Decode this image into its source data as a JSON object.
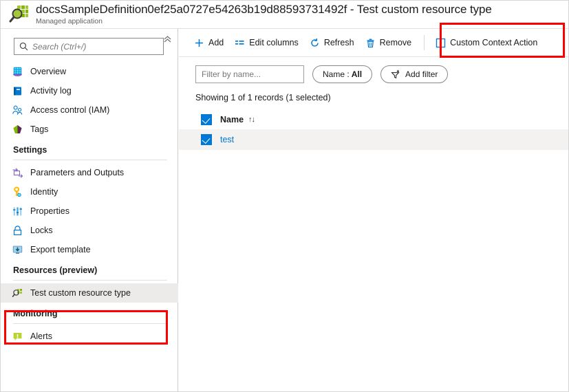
{
  "header": {
    "title": "docsSampleDefinition0ef25a0727e54263b19d88593731492f - Test custom resource type",
    "subtitle": "Managed application",
    "logo_icon": "custom-provider-magnifier-icon"
  },
  "sidebar": {
    "search": {
      "placeholder": "Search (Ctrl+/)",
      "value": "",
      "icon": "search-icon"
    },
    "collapse_icon": "double-chevron-up-icon",
    "items": [
      {
        "label": "Overview",
        "icon": "overview-cube-icon",
        "type": "item",
        "selected": false
      },
      {
        "label": "Activity log",
        "icon": "activity-log-icon",
        "type": "item",
        "selected": false
      },
      {
        "label": "Access control (IAM)",
        "icon": "access-control-icon",
        "type": "item",
        "selected": false
      },
      {
        "label": "Tags",
        "icon": "tags-icon",
        "type": "item",
        "selected": false
      },
      {
        "label": "Settings",
        "icon": "",
        "type": "group",
        "selected": false
      },
      {
        "label": "Parameters and Outputs",
        "icon": "parameters-outputs-icon",
        "type": "item",
        "selected": false
      },
      {
        "label": "Identity",
        "icon": "identity-key-icon",
        "type": "item",
        "selected": false
      },
      {
        "label": "Properties",
        "icon": "properties-icon",
        "type": "item",
        "selected": false
      },
      {
        "label": "Locks",
        "icon": "lock-icon",
        "type": "item",
        "selected": false
      },
      {
        "label": "Export template",
        "icon": "export-template-icon",
        "type": "item",
        "selected": false
      },
      {
        "label": "Resources (preview)",
        "icon": "",
        "type": "group",
        "selected": false
      },
      {
        "label": "Test custom resource type",
        "icon": "custom-resource-type-icon",
        "type": "item",
        "selected": true
      },
      {
        "label": "Monitoring",
        "icon": "",
        "type": "group",
        "selected": false
      },
      {
        "label": "Alerts",
        "icon": "alerts-icon",
        "type": "item",
        "selected": false
      }
    ]
  },
  "toolbar": {
    "buttons": [
      {
        "label": "Add",
        "icon": "plus-icon"
      },
      {
        "label": "Edit columns",
        "icon": "edit-columns-icon"
      },
      {
        "label": "Refresh",
        "icon": "refresh-icon"
      },
      {
        "label": "Remove",
        "icon": "trash-icon"
      },
      {
        "label": "Custom Context Action",
        "icon": "empty-checkbox-icon"
      }
    ]
  },
  "filters": {
    "name_filter": {
      "placeholder": "Filter by name...",
      "value": ""
    },
    "name_pill": {
      "prefix": "Name :",
      "value": "All"
    },
    "add_filter": {
      "label": "Add filter",
      "icon": "add-filter-icon"
    }
  },
  "status": {
    "records_text": "Showing 1 of 1 records (1 selected)"
  },
  "grid": {
    "columns": [
      {
        "label": "Name",
        "sort_icon": "↑↓"
      }
    ],
    "rows": [
      {
        "name": "test",
        "selected": true
      }
    ]
  },
  "colors": {
    "accent_blue": "#0078d4",
    "annotation_red": "#ff0000",
    "row_selected_bg": "#f3f2f1",
    "nav_selected_bg": "#edebe9",
    "brand_green": "#9cc816"
  }
}
